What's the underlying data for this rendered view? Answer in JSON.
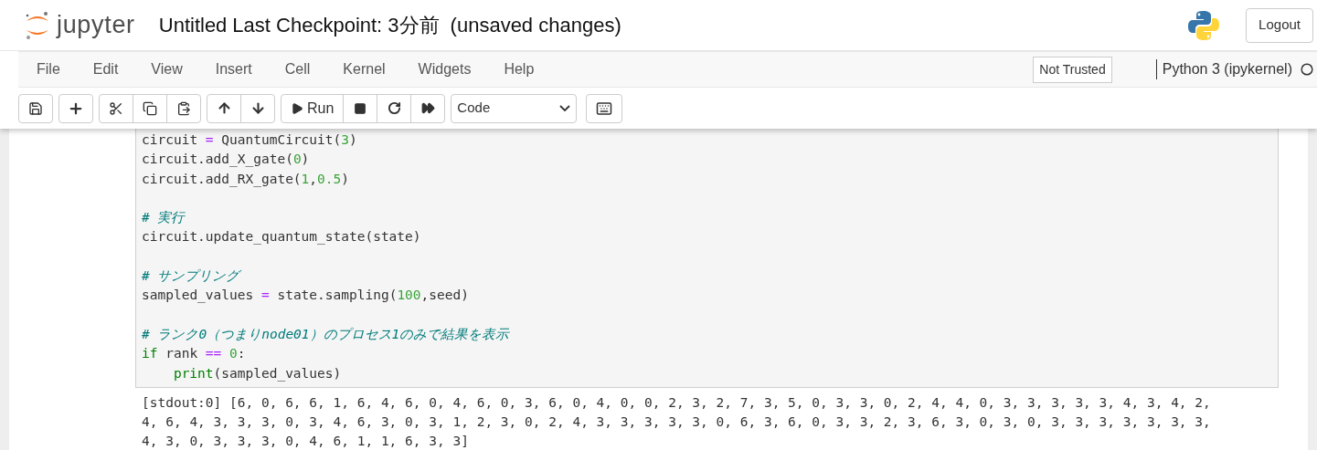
{
  "header": {
    "logo_text": "jupyter",
    "notebook_name": "Untitled",
    "checkpoint": "Last Checkpoint: 3分前",
    "autosave_status": "(unsaved changes)",
    "logout": "Logout"
  },
  "menu": [
    "File",
    "Edit",
    "View",
    "Insert",
    "Cell",
    "Kernel",
    "Widgets",
    "Help"
  ],
  "trust_indicator": "Not Trusted",
  "kernel": {
    "name": "Python 3 (ipykernel)",
    "busy": false
  },
  "toolbar": {
    "run_label": "Run",
    "cell_type": "Code"
  },
  "cell": {
    "lines": [
      {
        "kind": "code",
        "tokens": [
          {
            "kind": "plain",
            "text": "circuit "
          },
          {
            "kind": "operator",
            "text": "="
          },
          {
            "kind": "plain",
            "text": " QuantumCircuit("
          },
          {
            "kind": "number",
            "text": "3"
          },
          {
            "kind": "plain",
            "text": ")"
          }
        ]
      },
      {
        "kind": "code",
        "tokens": [
          {
            "kind": "plain",
            "text": "circuit.add_X_gate("
          },
          {
            "kind": "number",
            "text": "0"
          },
          {
            "kind": "plain",
            "text": ")"
          }
        ]
      },
      {
        "kind": "code",
        "tokens": [
          {
            "kind": "plain",
            "text": "circuit.add_RX_gate("
          },
          {
            "kind": "number",
            "text": "1"
          },
          {
            "kind": "plain",
            "text": ","
          },
          {
            "kind": "number",
            "text": "0.5"
          },
          {
            "kind": "plain",
            "text": ")"
          }
        ]
      },
      {
        "kind": "blank"
      },
      {
        "kind": "code",
        "tokens": [
          {
            "kind": "comment",
            "text": "# 実行"
          }
        ]
      },
      {
        "kind": "code",
        "tokens": [
          {
            "kind": "plain",
            "text": "circuit.update_quantum_state(state)"
          }
        ]
      },
      {
        "kind": "blank"
      },
      {
        "kind": "code",
        "tokens": [
          {
            "kind": "comment",
            "text": "# サンプリング"
          }
        ]
      },
      {
        "kind": "code",
        "tokens": [
          {
            "kind": "plain",
            "text": "sampled_values "
          },
          {
            "kind": "operator",
            "text": "="
          },
          {
            "kind": "plain",
            "text": " state.sampling("
          },
          {
            "kind": "number",
            "text": "100"
          },
          {
            "kind": "plain",
            "text": ",seed)"
          }
        ]
      },
      {
        "kind": "blank"
      },
      {
        "kind": "code",
        "tokens": [
          {
            "kind": "comment",
            "text": "# ランク0（つまりnode01）のプロセス1のみで結果を表示"
          }
        ]
      },
      {
        "kind": "code",
        "tokens": [
          {
            "kind": "keyword",
            "text": "if"
          },
          {
            "kind": "plain",
            "text": " rank "
          },
          {
            "kind": "operator",
            "text": "== "
          },
          {
            "kind": "number",
            "text": "0"
          },
          {
            "kind": "plain",
            "text": ":"
          }
        ]
      },
      {
        "kind": "code",
        "indent": true,
        "tokens": [
          {
            "kind": "builtin",
            "text": "print"
          },
          {
            "kind": "plain",
            "text": "(sampled_values)"
          }
        ]
      }
    ],
    "output": [
      "[stdout:0] [6, 0, 6, 6, 1, 6, 4, 6, 0, 4, 6, 0, 3, 6, 0, 4, 0, 0, 2, 3, 2, 7, 3, 5, 0, 3, 3, 0, 2, 4, 4, 0, 3, 3, 3, 3, 3, 4, 3, 4, 2,",
      "4, 6, 4, 3, 3, 3, 0, 3, 4, 6, 3, 0, 3, 1, 2, 3, 0, 2, 4, 3, 3, 3, 3, 3, 0, 6, 3, 6, 0, 3, 3, 2, 3, 6, 3, 0, 3, 0, 3, 3, 3, 3, 3, 3, 3,",
      "4, 3, 0, 3, 3, 3, 0, 4, 6, 1, 1, 6, 3, 3]"
    ]
  }
}
